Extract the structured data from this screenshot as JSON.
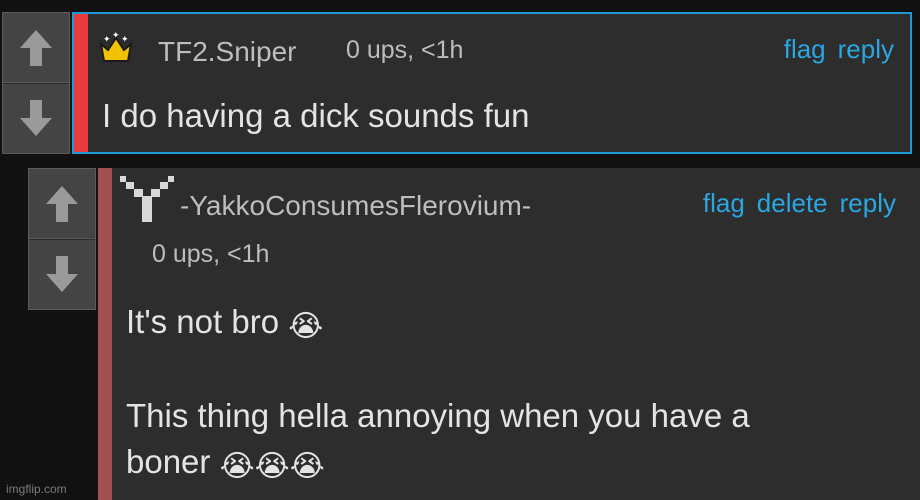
{
  "comments": [
    {
      "username": "TF2.Sniper",
      "meta": "0 ups, <1h",
      "actions": {
        "flag": "flag",
        "reply": "reply"
      },
      "text": "I do having a dick sounds fun",
      "badge_icon": "crown-icon",
      "border_color": "#1e9ad6",
      "bar_color": "#e93b3b"
    },
    {
      "username": "-YakkoConsumesFlerovium-",
      "meta": "0 ups, <1h",
      "actions": {
        "flag": "flag",
        "delete": "delete",
        "reply": "reply"
      },
      "line1": "It's not bro",
      "line2": "This thing hella annoying when you have a",
      "line3": "boner",
      "emoji": "😭",
      "avatar_icon": "y-logo-icon",
      "bar_color": "#a34f4f"
    }
  ],
  "watermark": "imgflip.com",
  "accent_color": "#2aa6e1"
}
